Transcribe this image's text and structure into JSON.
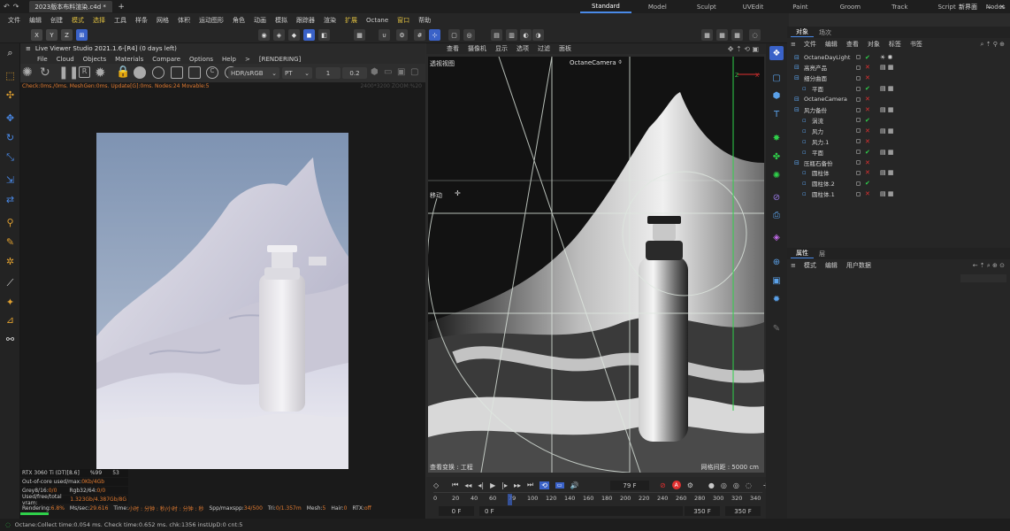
{
  "titlebar": {
    "tab_title": "2023版本布料渲染.c4d *",
    "new_tab": "+",
    "layouts": [
      "Standard",
      "Model",
      "Sculpt",
      "UVEdit",
      "Paint",
      "Groom",
      "Track",
      "Script",
      "Nodes"
    ],
    "active_layout": "Standard",
    "add_layout": "+",
    "new_ui": "新界面"
  },
  "menubar": [
    "文件",
    "编辑",
    "创建",
    "模式",
    "选择",
    "工具",
    "样条",
    "网格",
    "体积",
    "运动图形",
    "角色",
    "动画",
    "模拟",
    "跟踪器",
    "渲染",
    "扩展",
    "Octane",
    "窗口",
    "帮助"
  ],
  "axis_buttons": [
    "X",
    "Y",
    "Z"
  ],
  "live_viewer": {
    "title": "Live Viewer Studio 2021.1.6-[R4] (0 days left)",
    "menu": [
      "File",
      "Cloud",
      "Objects",
      "Materials",
      "Compare",
      "Options",
      "Help",
      ">",
      "[RENDERING]"
    ],
    "color_space": "HDR/sRGB",
    "kernel": "PT",
    "value1": "1",
    "value2": "0.2",
    "status_line": "Check:0ms./0ms. MeshGen:0ms. Update[G]:0ms. Nodes:24 Movable:5",
    "resolution_info": "2400*3200 ZOOM:%20",
    "stats": {
      "gpu": "RTX 3060 Ti (DT)[8.6]",
      "gpu_pct": "%99",
      "gpu_temp": "53",
      "out_of_core": "Out-of-core used/max:",
      "out_of_core_val": "0Kb/4Gb",
      "grey": "Grey8/16:",
      "grey_val": "0/0",
      "rgb": "Rgb32/64:",
      "rgb_val": "0/0",
      "vram": "Used/free/total vram:",
      "vram_val": "1.323Gb/4.387Gb/8G",
      "rendering": "Rendering:",
      "rendering_pct": "6.8%",
      "ms_sec": "Ms/sec:",
      "ms_sec_val": "29.616",
      "time": "Time:",
      "time_val": "小时 : 分钟 : 秒/小时 : 分钟 : 秒",
      "spp": "Spp/maxspp:",
      "spp_val": "34/500",
      "tri": "Tri:",
      "tri_val": "0/1.357m",
      "mesh": "Mesh:",
      "mesh_val": "5",
      "hair": "Hair:",
      "hair_val": "0",
      "rtx": "RTX:",
      "rtx_val": "off"
    }
  },
  "viewport": {
    "menu": [
      "查看",
      "摄像机",
      "显示",
      "选项",
      "过滤",
      "面板"
    ],
    "view_name": "透视视图",
    "camera": "OctaneCamera",
    "move_label": "移动",
    "bottom_left": "查看变换 : 工程",
    "grid_spacing": "网格间距 : 5000 cm"
  },
  "timeline": {
    "current_frame": "79 F",
    "ticks": [
      "0",
      "20",
      "40",
      "60",
      "79",
      "100",
      "120",
      "140",
      "160",
      "180",
      "200",
      "220",
      "240",
      "260",
      "280",
      "300",
      "320",
      "340"
    ],
    "start": "0 F",
    "start2": "0 F",
    "end": "350 F",
    "end2": "350 F"
  },
  "object_manager": {
    "tabs": [
      "对象",
      "场次"
    ],
    "menu": [
      "文件",
      "编辑",
      "查看",
      "对象",
      "标签",
      "书签"
    ],
    "objects": [
      {
        "name": "OctaneDayLight",
        "indent": 0
      },
      {
        "name": "高亮产品",
        "indent": 0
      },
      {
        "name": "细分曲面",
        "indent": 0
      },
      {
        "name": "平面",
        "indent": 1
      },
      {
        "name": "OctaneCamera",
        "indent": 0
      },
      {
        "name": "风力备份",
        "indent": 0
      },
      {
        "name": "涡流",
        "indent": 1
      },
      {
        "name": "风力",
        "indent": 1
      },
      {
        "name": "风力.1",
        "indent": 1
      },
      {
        "name": "平面",
        "indent": 1
      },
      {
        "name": "压瓶石备份",
        "indent": 0
      },
      {
        "name": "圆柱体",
        "indent": 1
      },
      {
        "name": "圆柱体.2",
        "indent": 1
      },
      {
        "name": "圆柱体.1",
        "indent": 1
      }
    ]
  },
  "properties": {
    "tabs": [
      "属性",
      "层"
    ],
    "menu": [
      "模式",
      "编辑",
      "用户数据"
    ]
  },
  "statusbar": "Octane:Collect time:0.054 ms.  Check time:0.652 ms.  chk:1356  instUpD:0  cnt:5",
  "colors": {
    "accent": "#3a62c8",
    "warning": "#e07a30",
    "green_axis": "#2fd04a",
    "red_axis": "#e03030"
  }
}
